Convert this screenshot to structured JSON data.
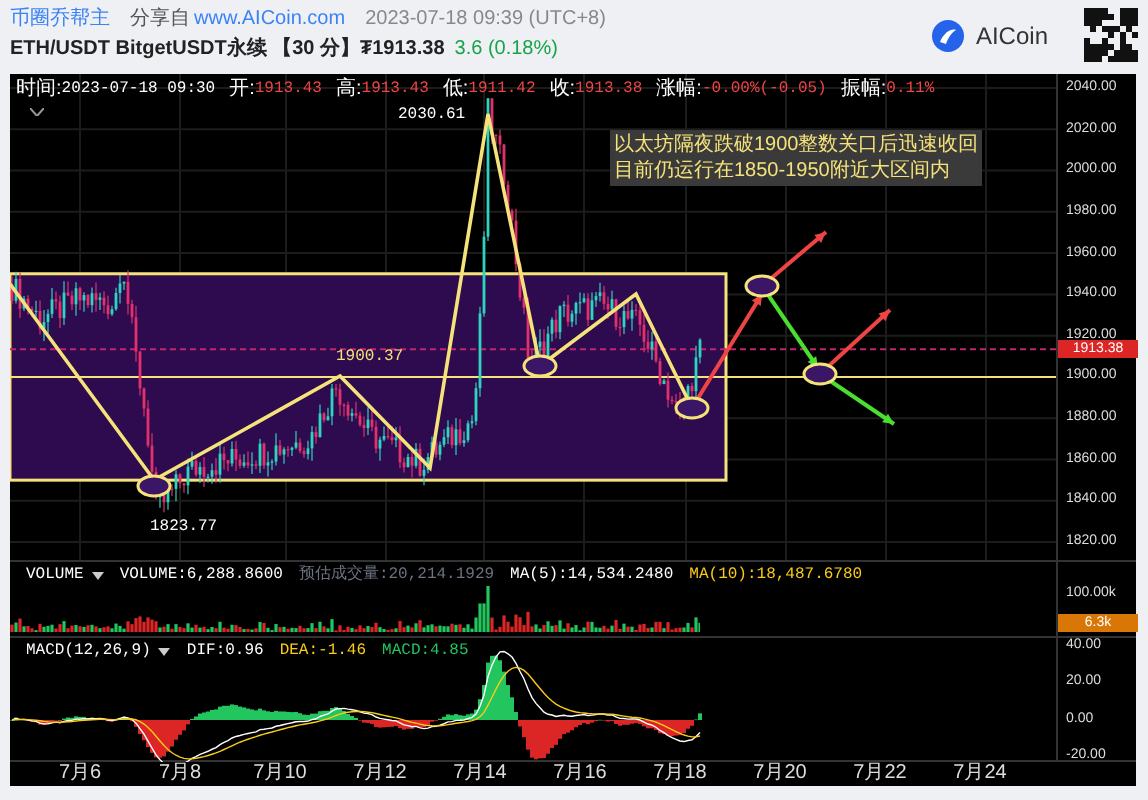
{
  "header": {
    "author": "币圈乔帮主",
    "share_label": "分享自",
    "share_link": "www.AICoin.com",
    "timestamp": "2023-07-18 09:39 (UTC+8)",
    "symbol": "ETH/USDT BitgetUSDT永续 【30 分】₮1913.38",
    "change": "3.6 (0.18%)",
    "logo_text": "AICoin"
  },
  "ohlc": [
    {
      "label": "时间:",
      "value": "2023-07-18 09:30",
      "color": "#ffffff"
    },
    {
      "label": "开:",
      "value": "1913.43",
      "color": "#ef4444"
    },
    {
      "label": "高:",
      "value": "1913.43",
      "color": "#ef4444"
    },
    {
      "label": "低:",
      "value": "1911.42",
      "color": "#ef4444"
    },
    {
      "label": "收:",
      "value": "1913.38",
      "color": "#ef4444"
    },
    {
      "label": "涨幅:",
      "value": "-0.00%(-0.05)",
      "color": "#ef4444"
    },
    {
      "label": "振幅:",
      "value": "0.11%",
      "color": "#ef4444"
    }
  ],
  "price_axis": [
    "2040.00",
    "2020.00",
    "2000.00",
    "1980.00",
    "1960.00",
    "1940.00",
    "1920.00",
    "1900.00",
    "1880.00",
    "1860.00",
    "1840.00",
    "1820.00"
  ],
  "current_price": "1913.38",
  "marks": {
    "high_label": "2030.61",
    "low_label": "1823.77",
    "level_label": "1900.37"
  },
  "note_lines": [
    "以太坊隔夜跌破1900整数关口后迅速收回",
    "目前仍运行在1850-1950附近大区间内"
  ],
  "volume": {
    "selector": "VOLUME",
    "readings": [
      {
        "text": "VOLUME:6,288.8600",
        "color": "#ffffff"
      },
      {
        "text": "预估成交量:20,214.1929",
        "color": "#6b7280"
      },
      {
        "text": "MA(5):14,534.2480",
        "color": "#ffffff"
      },
      {
        "text": "MA(10):18,487.6780",
        "color": "#facc15"
      }
    ],
    "axis": [
      "100.00k"
    ],
    "badge": "6.3k"
  },
  "macd": {
    "selector": "MACD(12,26,9)",
    "readings": [
      {
        "text": "DIF:0.96",
        "color": "#ffffff"
      },
      {
        "text": "DEA:-1.46",
        "color": "#facc15"
      },
      {
        "text": "MACD:4.85",
        "color": "#22c55e"
      }
    ],
    "axis": [
      "40.00",
      "20.00",
      "0.00",
      "-20.00"
    ]
  },
  "dates": [
    "7月6",
    "7月8",
    "7月10",
    "7月12",
    "7月14",
    "7月16",
    "7月18",
    "7月20",
    "7月22",
    "7月24"
  ]
}
